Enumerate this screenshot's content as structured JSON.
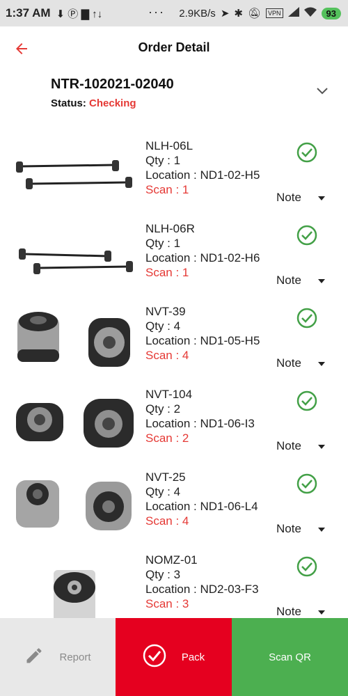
{
  "statusbar": {
    "time": "1:37 AM",
    "left_icons": "⬇ Ⓟ ▇ ↑↓",
    "dots": "···",
    "speed": "2.9KB/s",
    "vpn": "VPN",
    "battery": "93"
  },
  "header": {
    "title": "Order Detail"
  },
  "order": {
    "number": "NTR-102021-02040",
    "status_label": "Status:",
    "status_value": "Checking"
  },
  "items": [
    {
      "code": "NLH-06L",
      "qty": "Qty : 1",
      "location": "Location : ND1-02-H5",
      "scan": "Scan : 1",
      "note": "Note",
      "image": "stabilizer-link"
    },
    {
      "code": "NLH-06R",
      "qty": "Qty : 1",
      "location": "Location : ND1-02-H6",
      "scan": "Scan : 1",
      "note": "Note",
      "image": "stabilizer-link"
    },
    {
      "code": "NVT-39",
      "qty": "Qty : 4",
      "location": "Location : ND1-05-H5",
      "scan": "Scan : 4",
      "note": "Note",
      "image": "bushing"
    },
    {
      "code": "NVT-104",
      "qty": "Qty : 2",
      "location": "Location : ND1-06-I3",
      "scan": "Scan : 2",
      "note": "Note",
      "image": "bushing"
    },
    {
      "code": "NVT-25",
      "qty": "Qty : 4",
      "location": "Location : ND1-06-L4",
      "scan": "Scan : 4",
      "note": "Note",
      "image": "bushing"
    },
    {
      "code": "NOMZ-01",
      "qty": "Qty : 3",
      "location": "Location : ND2-03-F3",
      "scan": "Scan : 3",
      "note": "Note",
      "image": "oil-filter"
    }
  ],
  "bottom": {
    "report_label": "Report",
    "pack_label": "Pack",
    "scan_label": "Scan QR"
  },
  "colors": {
    "accent_red": "#e53935",
    "pack_red": "#e5001f",
    "scan_green": "#4caf50",
    "check_green": "#43a047"
  }
}
